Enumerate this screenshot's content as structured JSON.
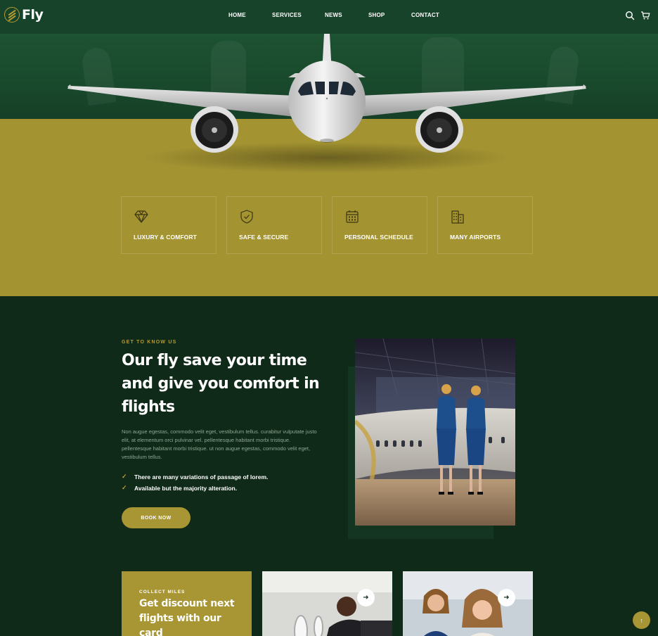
{
  "brand": {
    "name": "Fly",
    "accent": "#b79c33",
    "dark_green": "#0f2a18",
    "header_green": "#16432a",
    "olive": "#a39331"
  },
  "nav": {
    "items": [
      "HOME",
      "SERVICES",
      "NEWS",
      "SHOP",
      "CONTACT"
    ],
    "icons": [
      "search-icon",
      "cart-icon"
    ]
  },
  "features": [
    {
      "icon": "diamond-icon",
      "label": "LUXURY & COMFORT"
    },
    {
      "icon": "shield-check-icon",
      "label": "SAFE & SECURE"
    },
    {
      "icon": "calendar-icon",
      "label": "PERSONAL SCHEDULE"
    },
    {
      "icon": "building-icon",
      "label": "MANY AIRPORTS"
    }
  ],
  "about": {
    "eyebrow": "GET TO KNOW US",
    "title": "Our fly save your time and give you comfort in flights",
    "text": "Non augue egestas, commodo velit eget, vestibulum tellus. curabitur vulputate justo elit, at elementum orci pulvinar vel. pellentesque habitant morbi tristique. pellentesque habitant morbi tristique. ut non augue egestas, commodo velit eget, vestibulum tellus.",
    "checks": [
      "There are many variations of passage of lorem.",
      "Available but the majority alteration."
    ],
    "button": "BOOK NOW"
  },
  "cards": {
    "miles_eyebrow": "COLLECT MILES",
    "miles_title": "Get discount next flights with our card",
    "arrow_icon": "arrow-right-icon"
  },
  "scroll_top_icon": "arrow-up-icon"
}
